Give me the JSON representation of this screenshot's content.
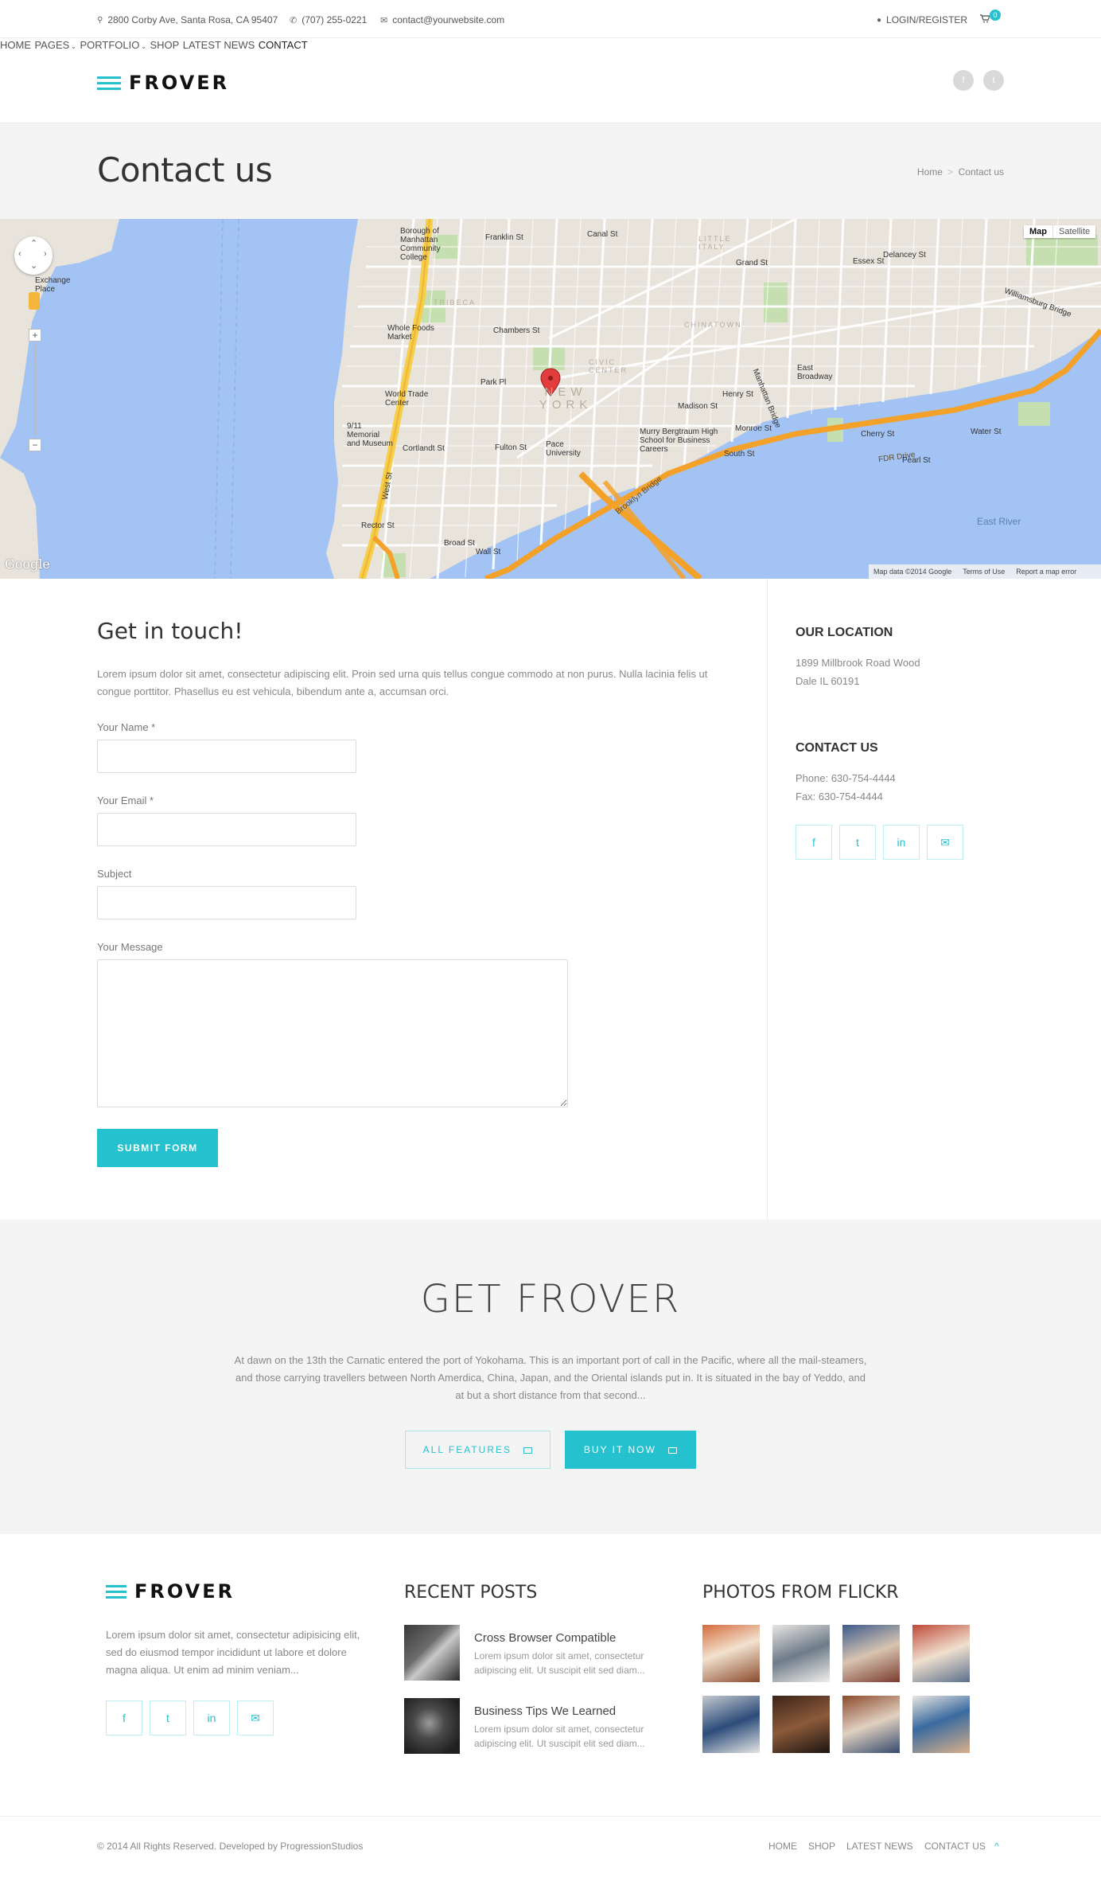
{
  "topbar": {
    "address": "2800 Corby Ave, Santa Rosa, CA 95407",
    "phone": "(707) 255-0221",
    "email": "contact@yourwebsite.com",
    "login": "LOGIN/REGISTER",
    "cart_count": "0"
  },
  "brand": {
    "name": "FROVER",
    "accent": "#26c1cf"
  },
  "nav": {
    "items": [
      "HOME",
      "PAGES",
      "PORTFOLIO",
      "SHOP",
      "LATEST NEWS",
      "CONTACT"
    ],
    "active": "CONTACT",
    "social": [
      "f",
      "t"
    ]
  },
  "page": {
    "title": "Contact us",
    "breadcrumb_home": "Home",
    "breadcrumb_sep": ">",
    "breadcrumb_current": "Contact us"
  },
  "map": {
    "type_map": "Map",
    "type_satellite": "Satellite",
    "attribution": "Map data ©2014 Google",
    "terms": "Terms of Use",
    "report": "Report a map error",
    "google": "Google",
    "labels": [
      "NEW YORK",
      "TRIBECA",
      "CHINATOWN",
      "LITTLE ITALY",
      "CIVIC CENTER",
      "East River",
      "FDR Drive",
      "Brooklyn Bridge",
      "Manhattan Bridge",
      "Williamsburg Bridge",
      "Borough of Manhattan Community College",
      "World Trade Center",
      "9/11 Memorial and Museum",
      "Whole Foods Market",
      "Pace University",
      "Murry Bergtraum High School for Business Careers",
      "Exchange Place",
      "Canal St",
      "Grand St",
      "Chambers St",
      "Fulton St",
      "Wall St",
      "Broad St",
      "Delancey St",
      "Madison St",
      "South St",
      "Park Pl",
      "Cortlandt St",
      "Rector St",
      "Franklin St",
      "Essex St",
      "East Broadway",
      "Henry St",
      "Cherry St",
      "Water St",
      "Pearl St",
      "West St",
      "Monroe St"
    ]
  },
  "contact_form": {
    "heading": "Get in touch!",
    "intro": "Lorem ipsum dolor sit amet, consectetur adipiscing elit. Proin sed urna quis tellus congue commodo at non purus. Nulla lacinia felis ut congue porttitor. Phasellus eu est vehicula, bibendum ante a, accumsan orci.",
    "name_label": "Your Name *",
    "email_label": "Your Email *",
    "subject_label": "Subject",
    "message_label": "Your Message",
    "submit": "SUBMIT FORM"
  },
  "sidebar": {
    "location_heading": "OUR LOCATION",
    "location_line1": "1899 Millbrook Road Wood",
    "location_line2": "Dale IL 60191",
    "contact_heading": "CONTACT US",
    "phone": "Phone: 630-754-4444",
    "fax": "Fax: 630-754-4444",
    "social": [
      "f",
      "t",
      "in",
      "✉"
    ]
  },
  "cta": {
    "title": "GET FROVER",
    "text": "At dawn on the 13th the Carnatic entered the port of Yokohama. This is an important port of call in the Pacific, where all the mail-steamers, and those carrying travellers between North Amerdica, China, Japan, and the Oriental islands put in. It is situated in the bay of Yeddo, and at but a short distance from that second...",
    "all_features": "ALL FEATURES",
    "buy_now": "BUY IT NOW"
  },
  "footer": {
    "about": "Lorem ipsum dolor sit amet, consectetur adipisicing elit, sed do eiusmod tempor incididunt ut labore et dolore magna aliqua. Ut enim ad minim veniam...",
    "social": [
      "f",
      "t",
      "in",
      "✉"
    ],
    "recent_heading": "RECENT POSTS",
    "posts": [
      {
        "title": "Cross Browser Compatible",
        "excerpt": "Lorem ipsum dolor sit amet, consectetur adipiscing elit. Ut suscipit elit sed diam..."
      },
      {
        "title": "Business Tips We Learned",
        "excerpt": "Lorem ipsum dolor sit amet, consectetur adipiscing elit. Ut suscipit elit sed diam..."
      }
    ],
    "flickr_heading": "PHOTOS FROM FLICKR",
    "copyright": "© 2014 All Rights Reserved. Developed by ProgressionStudios",
    "bottom_nav": [
      "HOME",
      "SHOP",
      "LATEST NEWS",
      "CONTACT US"
    ],
    "to_top": "^"
  }
}
